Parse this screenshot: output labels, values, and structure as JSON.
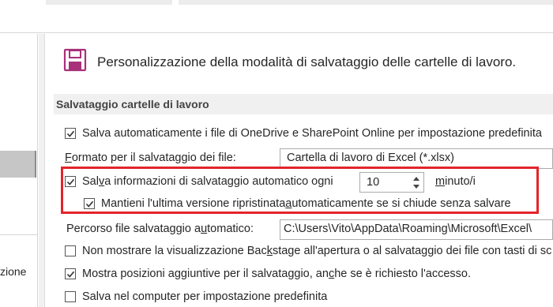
{
  "header": {
    "title": "Personalizzazione della modalità di salvataggio delle cartelle di lavoro.",
    "icon": "floppy-disk-icon",
    "icon_color": "#a8307b"
  },
  "section": {
    "title": "Salvataggio cartelle di lavoro"
  },
  "nav": {
    "partial_label": "zione"
  },
  "options": {
    "autosave_onedrive": {
      "checked": true,
      "label": "Salva automaticamente i file di OneDrive e SharePoint Online per impostazione predefinita"
    },
    "format": {
      "label_pre": "",
      "label_accel": "F",
      "label_post": "ormato per il salvataggio dei file:",
      "selected": "Cartella di lavoro di Excel (*.xlsx)"
    },
    "autorecover": {
      "checked": true,
      "label_pre": "Sal",
      "label_accel": "v",
      "label_post": "a informazioni di salvataggio automatico ogni",
      "minutes": "10",
      "unit_pre": "",
      "unit_accel": "m",
      "unit_post": "inuto/i"
    },
    "keep_last": {
      "checked": true,
      "label_pre": "Mantieni l'ultima versione ripristinata ",
      "label_accel": "a",
      "label_post": "utomaticamente se si chiude senza salvare"
    },
    "autorecover_path": {
      "label_pre": "Percorso file salvataggio a",
      "label_accel": "u",
      "label_post": "tomatico:",
      "value": "C:\\Users\\Vito\\AppData\\Roaming\\Microsoft\\Excel\\"
    },
    "no_backstage": {
      "checked": false,
      "label_pre": "Non mostrare la visualizzazione Bac",
      "label_accel": "k",
      "label_post": "stage all'apertura o al salvataggio dei file con tasti di sc"
    },
    "show_locations": {
      "checked": true,
      "label_pre": "Mostra posizioni aggiuntive per il salvataggio, an",
      "label_accel": "c",
      "label_post": "he se è richiesto l'accesso."
    },
    "save_computer": {
      "checked": false,
      "label_pre": "Salva nel computer per impostazione predefinita",
      "label_accel": "",
      "label_post": ""
    }
  },
  "colors": {
    "highlight": "#e3242b",
    "section_band": "#f0f0f0",
    "nav_selected": "#c6c6c6"
  }
}
